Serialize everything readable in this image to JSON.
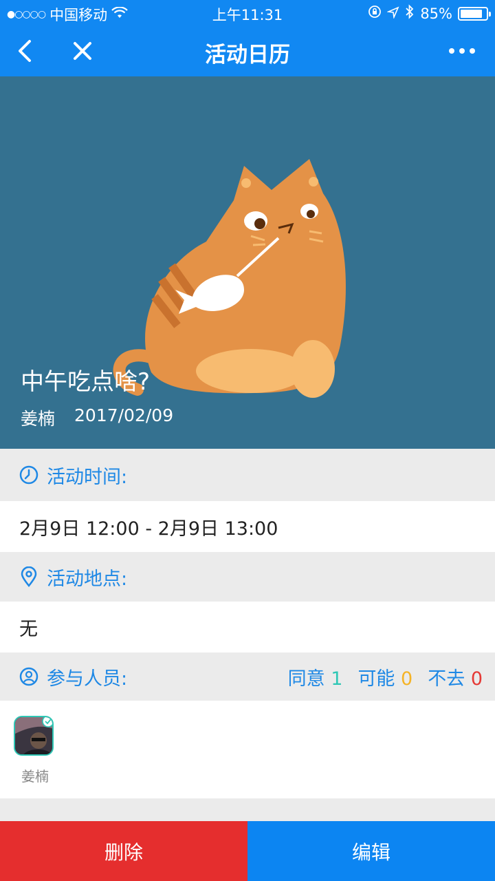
{
  "status_bar": {
    "signal": "●○○○○",
    "carrier": "中国移动",
    "time": "上午11:31",
    "battery": "85%",
    "battery_level": 0.85
  },
  "nav": {
    "title": "活动日历",
    "back_icon": "chevron-left-icon",
    "close_icon": "close-icon",
    "more_icon": "more-dots-icon"
  },
  "hero": {
    "title": "中午吃点啥?",
    "author": "姜楠",
    "date": "2017/02/09",
    "background": "#347190"
  },
  "time_section": {
    "label": "活动时间:",
    "value": "2月9日 12:00 - 2月9日 13:00"
  },
  "location_section": {
    "label": "活动地点:",
    "value": "无"
  },
  "participants_section": {
    "label": "参与人员:",
    "agree_label": "同意",
    "agree_count": "1",
    "maybe_label": "可能",
    "maybe_count": "0",
    "decline_label": "不去",
    "decline_count": "0",
    "members": [
      {
        "name": "姜楠",
        "status": "agreed"
      }
    ]
  },
  "footer": {
    "delete_label": "删除",
    "edit_label": "编辑"
  },
  "colors": {
    "primary": "#1188f2",
    "delete": "#e52e2e",
    "agree": "#2ec7b5",
    "maybe": "#f5b326",
    "decline": "#e53935"
  }
}
